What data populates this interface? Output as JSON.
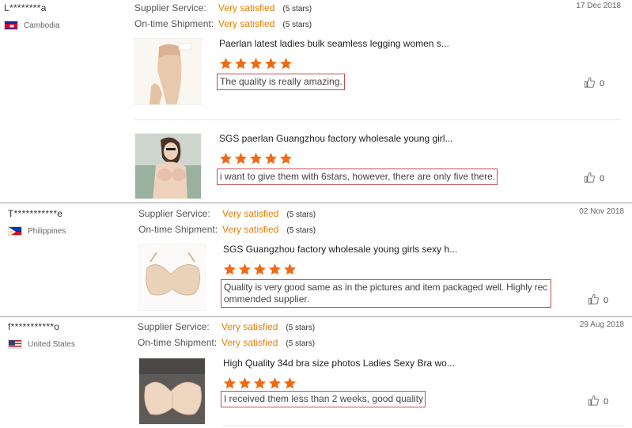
{
  "reviews": [
    {
      "buyer": "L********a",
      "country": "Cambodia",
      "flag": "cambodia-flag-icon",
      "date": "17 Dec 2018",
      "supplier_service_label": "Supplier Service:",
      "supplier_service_value": "Very satisfied",
      "supplier_service_stars": "(5 stars)",
      "shipment_label": "On-time Shipment:",
      "shipment_value": "Very satisfied",
      "shipment_stars": "(5 stars)",
      "items": [
        {
          "title": "Paerlan latest ladies bulk seamless legging women s...",
          "rating": 5,
          "feedback": "The quality is really amazing.",
          "likes": "0"
        },
        {
          "title": "SGS paerlan Guangzhou factory wholesale young girl...",
          "rating": 5,
          "feedback": "i want to give them with 6stars, however, there are only five there.",
          "likes": "0"
        }
      ]
    },
    {
      "buyer": "T***********e",
      "country": "Philippines",
      "flag": "philippines-flag-icon",
      "date": "02 Nov 2018",
      "supplier_service_label": "Supplier Service:",
      "supplier_service_value": "Very satisfied",
      "supplier_service_stars": "(5 stars)",
      "shipment_label": "On-time Shipment:",
      "shipment_value": "Very satisfied",
      "shipment_stars": "(5 stars)",
      "items": [
        {
          "title": "SGS Guangzhou factory wholesale young girls sexy h...",
          "rating": 5,
          "feedback_line1": "Quality is very good same as in the pictures and item packaged well. Highly rec",
          "feedback_line2": "ommended supplier.",
          "likes": "0"
        }
      ]
    },
    {
      "buyer": "f***********o",
      "country": "United States",
      "flag": "united-states-flag-icon",
      "date": "29 Aug 2018",
      "supplier_service_label": "Supplier Service:",
      "supplier_service_value": "Very satisfied",
      "supplier_service_stars": "(5 stars)",
      "shipment_label": "On-time Shipment:",
      "shipment_value": "Very satisfied",
      "shipment_stars": "(5 stars)",
      "items": [
        {
          "title": "High Quality 34d bra size photos Ladies Sexy Bra wo...",
          "rating": 5,
          "feedback": "I received them less than 2 weeks, good quality",
          "likes": "0"
        }
      ]
    }
  ],
  "colors": {
    "accent": "#e87e04",
    "star": "#f06a14",
    "highlight_border": "#c0504d",
    "divider": "#9a9a9a"
  },
  "icons": {
    "star": "star-icon",
    "like": "thumbs-up-icon"
  }
}
